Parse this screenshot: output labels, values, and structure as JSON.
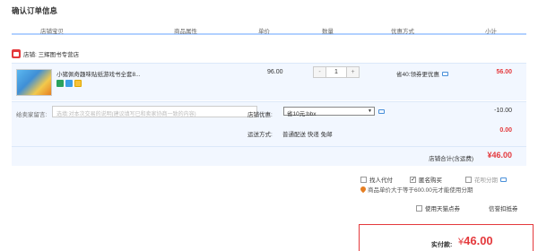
{
  "page": {
    "title": "确认订单信息"
  },
  "table_header": {
    "columns": [
      "店铺宝贝",
      "商品属性",
      "单价",
      "数量",
      "优惠方式",
      "小计"
    ]
  },
  "shop": {
    "name": "店铺: 三辉图书专营店"
  },
  "item": {
    "name": "小猪佩奇趣味贴纸游戏书全套8...",
    "price": "96.00",
    "quantity": "1",
    "minus_label": "-",
    "plus_label": "+",
    "promo": "省40:领券更优惠",
    "subtotal": "56.00"
  },
  "extra": {
    "message_label": "给卖家留言:",
    "message_placeholder": "选填:对本次交易的说明(建议填写已和卖家协商一致的内容)",
    "shop_promo_label": "店铺优惠:",
    "shop_promo_value": "省10元:bbx",
    "shop_promo_discount": "-10.00",
    "shipping_label": "运送方式:",
    "shipping_value": "普通配送 快递 免邮",
    "shipping_price": "0.00"
  },
  "store_total": {
    "label": "店铺合计(含运费)",
    "value": "¥46.00"
  },
  "options": {
    "pay_for_others": "找人代付",
    "anonymous": "匿名购买",
    "installment": "花呗分期",
    "notice": "商品单价大于等于600.00元才能使用分期",
    "tmall_points": "使用天猫点券",
    "use_cert": "信誉扣抵券"
  },
  "payment": {
    "label": "实付款:",
    "currency": "¥",
    "amount": "46.00"
  },
  "colors": {
    "accent_red": "#e4393c",
    "row_bg": "#f2f7ff",
    "header_line": "#b2d1ff"
  }
}
